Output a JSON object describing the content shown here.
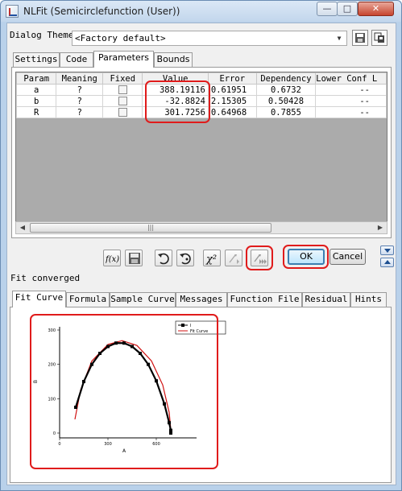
{
  "window": {
    "title": "NLFit (Semicirclefunction (User))",
    "buttons": {
      "minimize": "—",
      "maximize": "□",
      "close": "✕"
    }
  },
  "theme": {
    "label": "Dialog Theme",
    "selected": "<Factory default>"
  },
  "top_tabs": [
    "Settings",
    "Code",
    "Parameters",
    "Bounds"
  ],
  "active_top_tab": "Parameters",
  "param_table": {
    "columns": [
      "Param",
      "Meaning",
      "Fixed",
      "Value",
      "Error",
      "Dependency",
      "Lower Conf L"
    ],
    "rows": [
      {
        "param": "a",
        "meaning": "?",
        "value": "388.19116",
        "error": "0.61951",
        "dependency": "0.6732",
        "lower": "--"
      },
      {
        "param": "b",
        "meaning": "?",
        "value": "-32.8824",
        "error": "2.15305",
        "dependency": "0.50428",
        "lower": "--"
      },
      {
        "param": "R",
        "meaning": "?",
        "value": "301.7256",
        "error": "0.64968",
        "dependency": "0.7855",
        "lower": "--"
      }
    ]
  },
  "toolbar": {
    "icons": [
      "fit-icon",
      "save-icon",
      "iterate-icon",
      "init-icon",
      "chi-square-icon",
      "one-iteration-icon",
      "fit-until-converge-icon"
    ],
    "chi_label": "χ²",
    "fit_label": "f(x)"
  },
  "actions": {
    "ok": "OK",
    "cancel": "Cancel"
  },
  "status": "Fit converged",
  "bottom_tabs": [
    "Fit Curve",
    "Formula",
    "Sample Curve",
    "Messages",
    "Function File",
    "Residual",
    "Hints"
  ],
  "active_bottom_tab": "Fit Curve",
  "graph": {
    "legend": [
      "I",
      "Fit Curve"
    ],
    "x_ticks": [
      "0",
      "300",
      "600"
    ],
    "y_ticks": [
      "0",
      "100",
      "200",
      "300"
    ],
    "xlabel": "A",
    "ylabel": "B",
    "colors": {
      "data": "#000000",
      "fit": "#d01010"
    }
  },
  "chart_data": {
    "type": "scatter",
    "title": "",
    "xlabel": "A",
    "ylabel": "B",
    "xlim": [
      0,
      800
    ],
    "ylim": [
      0,
      300
    ],
    "x_ticks": [
      0,
      300,
      600
    ],
    "y_ticks": [
      0,
      100,
      200,
      300
    ],
    "series": [
      {
        "name": "I",
        "style": "markers",
        "color": "#000000",
        "x": [
          100,
          150,
          200,
          250,
          300,
          350,
          400,
          450,
          500,
          550,
          600,
          650,
          680,
          690,
          690
        ],
        "y": [
          75,
          150,
          200,
          232,
          252,
          262,
          262,
          252,
          232,
          200,
          152,
          85,
          30,
          8,
          0
        ]
      },
      {
        "name": "Fit Curve",
        "style": "line",
        "color": "#d01010",
        "x": [
          95,
          130,
          200,
          300,
          388,
          480,
          570,
          640,
          680,
          690
        ],
        "y": [
          40,
          125,
          210,
          258,
          269,
          255,
          210,
          140,
          60,
          10
        ]
      }
    ],
    "legend_position": "top-right",
    "grid": false
  }
}
